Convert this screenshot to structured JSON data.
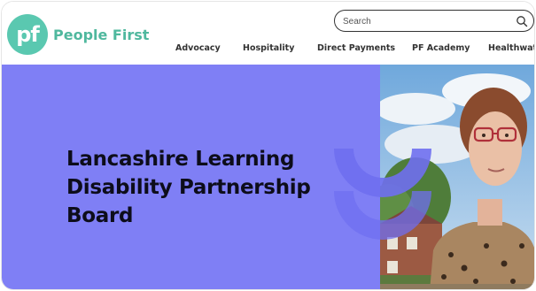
{
  "brand": {
    "logo_mark": "pf",
    "name": "People First"
  },
  "search": {
    "placeholder": "Search",
    "icon": "search-icon"
  },
  "nav": {
    "items": [
      {
        "label": "Advocacy"
      },
      {
        "label": "Hospitality"
      },
      {
        "label": "Direct Payments"
      },
      {
        "label": "PF Academy"
      },
      {
        "label": "Healthwatch"
      }
    ]
  },
  "hero": {
    "title_lines": [
      "Lancashire Learning",
      "Disability Partnership",
      "Board"
    ]
  },
  "colors": {
    "brand_teal": "#5ac8b0",
    "hero_purple": "#7f7ff5",
    "shape_purple": "#6f6ff0"
  }
}
